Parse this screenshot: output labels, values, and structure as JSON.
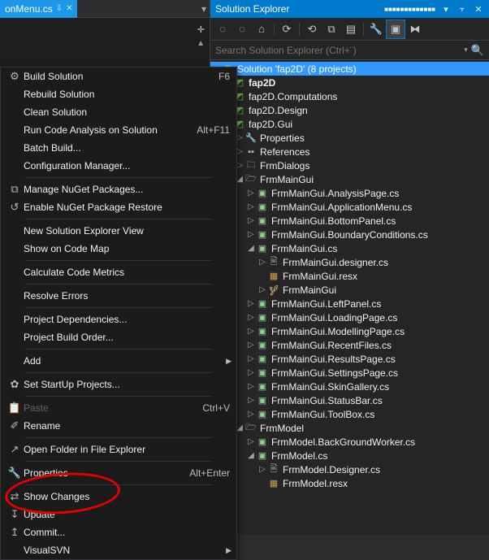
{
  "tab": {
    "filename": "onMenu.cs"
  },
  "panel": {
    "title": "Solution Explorer",
    "search_placeholder": "Search Solution Explorer (Ctrl+¨)"
  },
  "menu": {
    "build_solution": "Build Solution",
    "build_solution_shortcut": "F6",
    "rebuild_solution": "Rebuild Solution",
    "clean_solution": "Clean Solution",
    "run_code_analysis": "Run Code Analysis on Solution",
    "run_code_analysis_shortcut": "Alt+F11",
    "batch_build": "Batch Build...",
    "config_manager": "Configuration Manager...",
    "manage_nuget": "Manage NuGet Packages...",
    "enable_nuget": "Enable NuGet Package Restore",
    "new_solexp": "New Solution Explorer View",
    "show_code_map": "Show on Code Map",
    "calc_metrics": "Calculate Code Metrics",
    "resolve_errors": "Resolve Errors",
    "proj_deps": "Project Dependencies...",
    "proj_build_order": "Project Build Order...",
    "add": "Add",
    "set_startup": "Set StartUp Projects...",
    "paste": "Paste",
    "paste_shortcut": "Ctrl+V",
    "rename": "Rename",
    "open_folder": "Open Folder in File Explorer",
    "properties": "Properties",
    "properties_shortcut": "Alt+Enter",
    "show_changes": "Show Changes",
    "update": "Update",
    "commit": "Commit...",
    "visualsvn": "VisualSVN"
  },
  "tree": {
    "solution": "Solution 'fap2D' (8 projects)",
    "proj_fap2d": "fap2D",
    "proj_comp": "fap2D.Computations",
    "proj_design": "fap2D.Design",
    "proj_gui": "fap2D.Gui",
    "properties": "Properties",
    "references": "References",
    "frmdialogs": "FrmDialogs",
    "frmmaingui_folder": "FrmMainGui",
    "f_analysis": "FrmMainGui.AnalysisPage.cs",
    "f_appmenu": "FrmMainGui.ApplicationMenu.cs",
    "f_bottom": "FrmMainGui.BottomPanel.cs",
    "f_boundary": "FrmMainGui.BoundaryConditions.cs",
    "f_maincs": "FrmMainGui.cs",
    "f_main_designer": "FrmMainGui.designer.cs",
    "f_main_resx": "FrmMainGui.resx",
    "f_main_class": "FrmMainGui",
    "f_left": "FrmMainGui.LeftPanel.cs",
    "f_loading": "FrmMainGui.LoadingPage.cs",
    "f_modelling": "FrmMainGui.ModellingPage.cs",
    "f_recent": "FrmMainGui.RecentFiles.cs",
    "f_results": "FrmMainGui.ResultsPage.cs",
    "f_settings": "FrmMainGui.SettingsPage.cs",
    "f_skin": "FrmMainGui.SkinGallery.cs",
    "f_status": "FrmMainGui.StatusBar.cs",
    "f_toolbox": "FrmMainGui.ToolBox.cs",
    "frmmodel_folder": "FrmModel",
    "m_bgworker": "FrmModel.BackGroundWorker.cs",
    "m_modelcs": "FrmModel.cs",
    "m_designer": "FrmModel.Designer.cs",
    "m_resx": "FrmModel.resx"
  }
}
